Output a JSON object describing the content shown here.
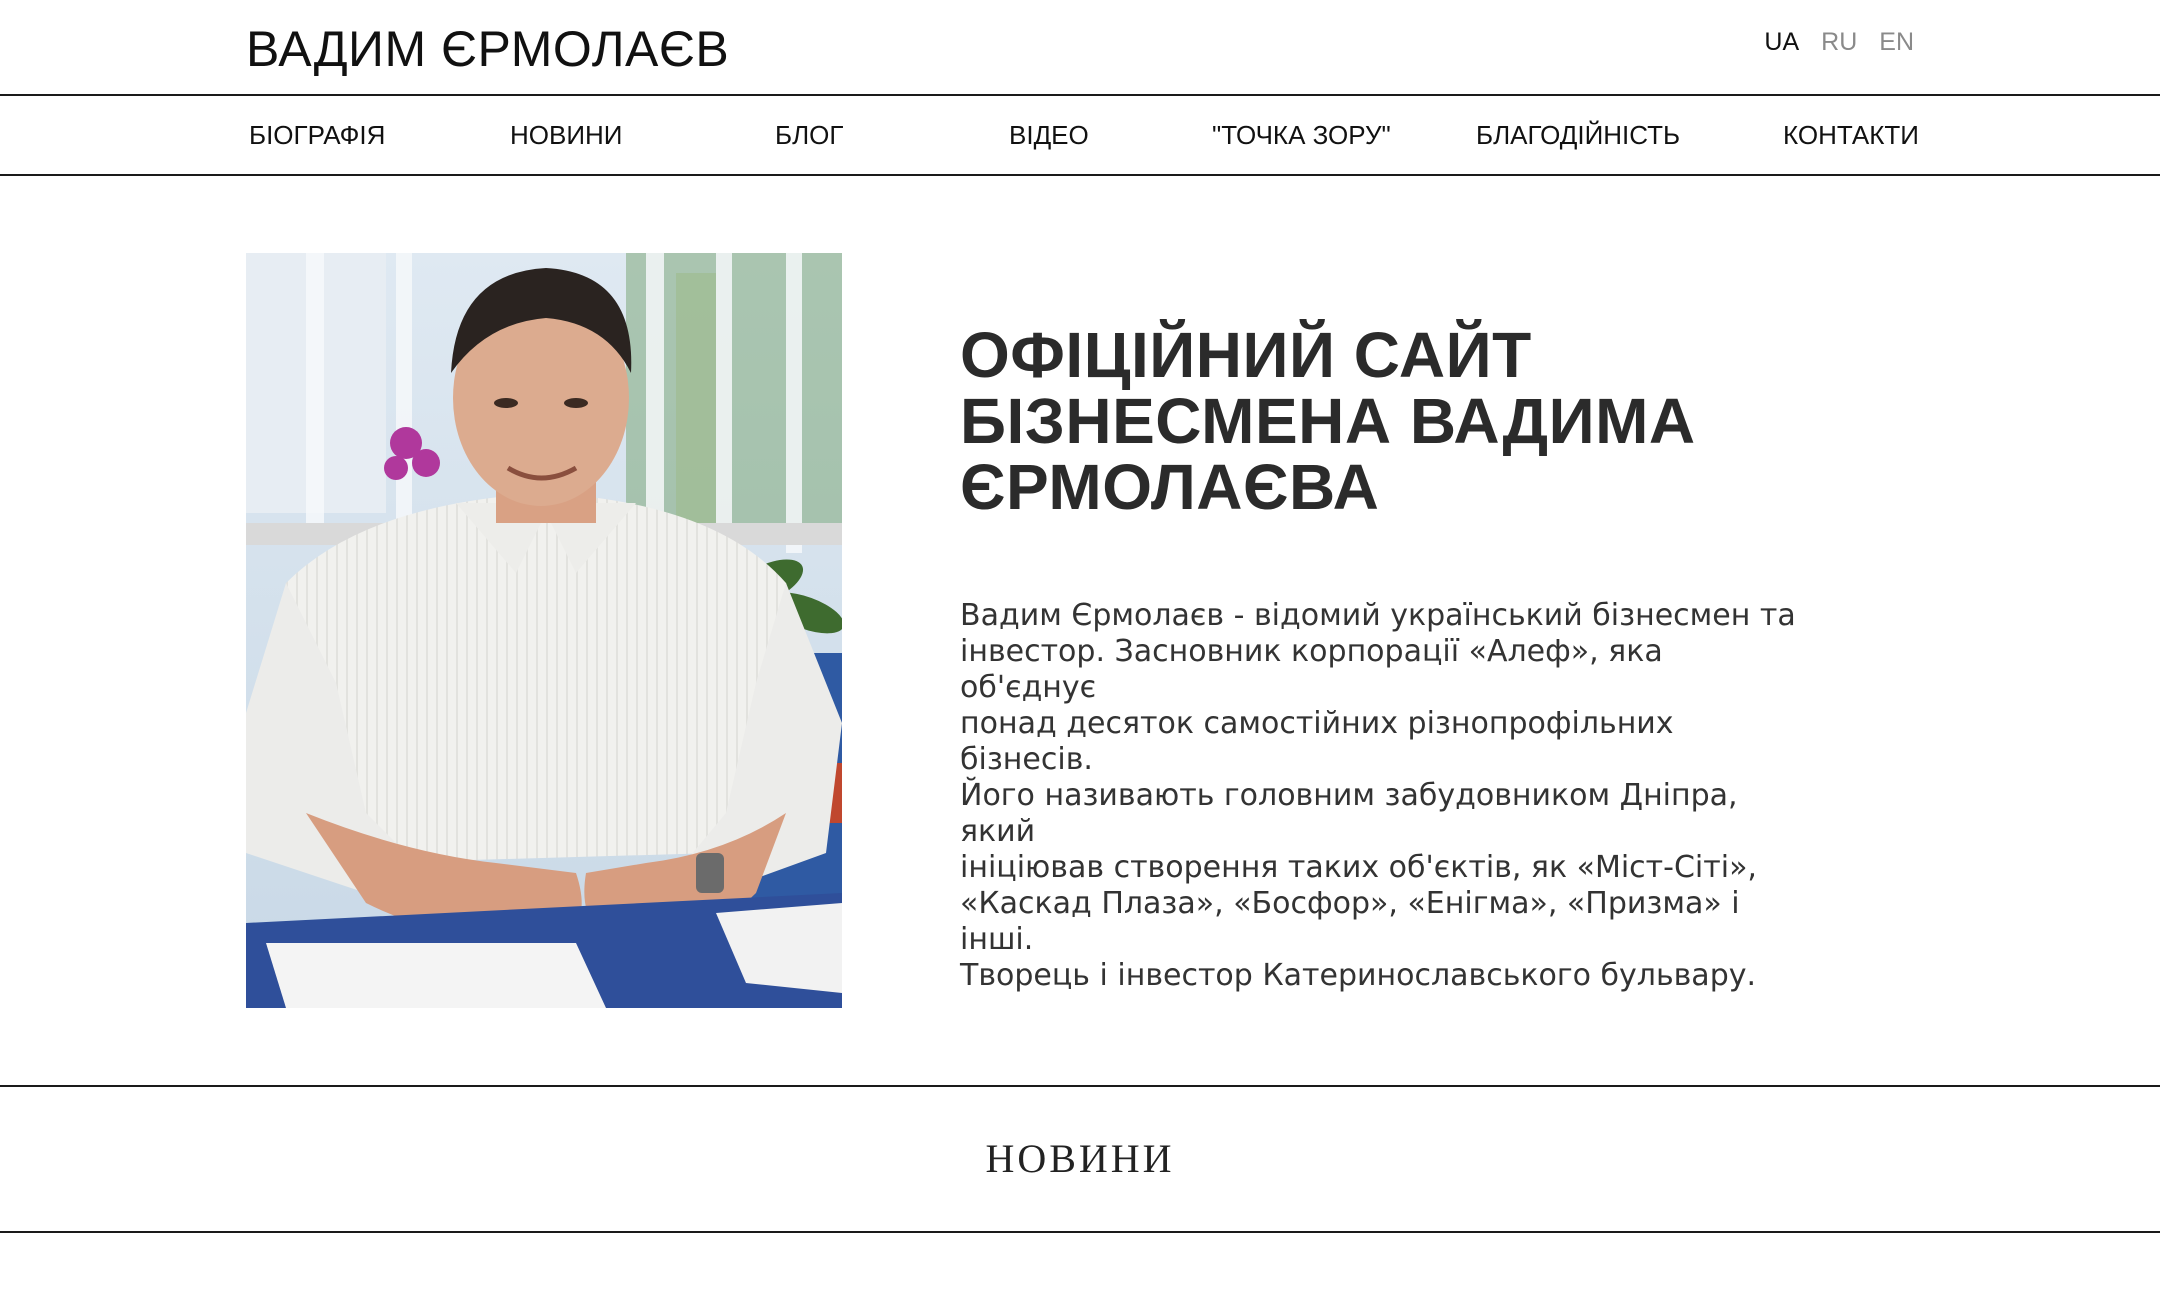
{
  "header": {
    "site_title": "ВАДИМ ЄРМОЛАЄВ",
    "languages": [
      "UA",
      "RU",
      "EN"
    ],
    "active_language": "UA"
  },
  "nav": {
    "items": [
      {
        "label": "БІОГРАФІЯ"
      },
      {
        "label": "НОВИНИ"
      },
      {
        "label": "БЛОГ"
      },
      {
        "label": "ВІДЕО"
      },
      {
        "label": "\"ТОЧКА ЗОРУ\""
      },
      {
        "label": "БЛАГОДІЙНІСТЬ"
      },
      {
        "label": "КОНТАКТИ"
      }
    ]
  },
  "hero": {
    "title_lines": [
      "ОФІЦІЙНИЙ САЙТ",
      "БІЗНЕСМЕНА ВАДИМА",
      "ЄРМОЛАЄВА"
    ],
    "text_lines": [
      "Вадим Єрмолаєв - відомий український бізнесмен та",
      "інвестор. Засновник корпорації «Алеф», яка об'єднує",
      "понад десяток самостійних різнопрофільних бізнесів.",
      "Його називають головним забудовником Дніпра, який",
      "ініціював створення таких об'єктів, як «Міст-Сіті»,",
      "«Каскад Плаза», «Босфор», «Енігма», «Призма» і інші.",
      "Творець і інвестор Катеринославського бульвару."
    ],
    "photo_icon": "portrait-photo"
  },
  "news": {
    "heading": "НОВИНИ"
  }
}
